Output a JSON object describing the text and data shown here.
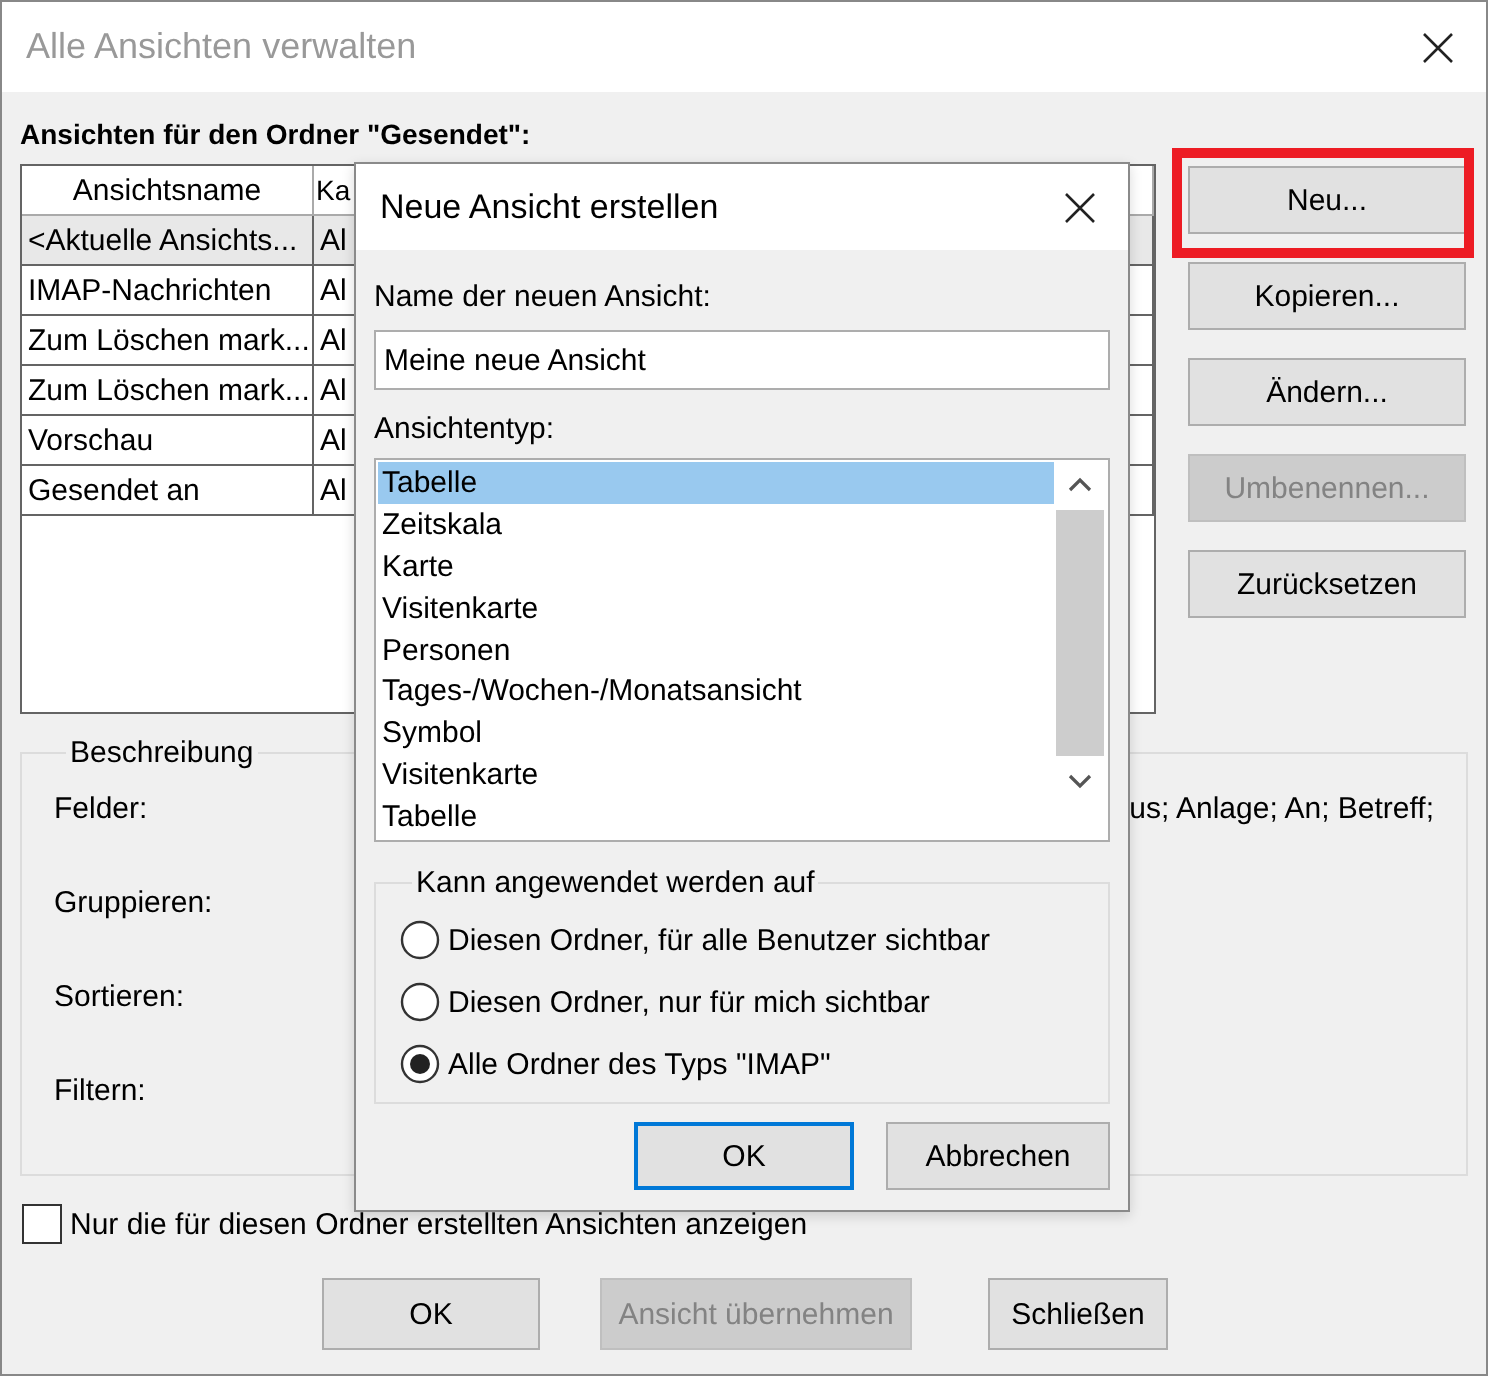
{
  "window": {
    "title": "Alle Ansichten verwalten"
  },
  "views_label": "Ansichten für den Ordner \"Gesendet\":",
  "table": {
    "columns": [
      "Ansichtsname",
      "Ka"
    ],
    "rows": [
      {
        "cells": [
          "<Aktuelle Ansichts...",
          "Al"
        ],
        "selected": true
      },
      {
        "cells": [
          "IMAP-Nachrichten",
          "Al"
        ],
        "selected": false
      },
      {
        "cells": [
          "Zum Löschen mark...",
          "Al"
        ],
        "selected": false
      },
      {
        "cells": [
          "Zum Löschen mark...",
          "Al"
        ],
        "selected": false
      },
      {
        "cells": [
          "Vorschau",
          "Al"
        ],
        "selected": false
      },
      {
        "cells": [
          "Gesendet an",
          "Al"
        ],
        "selected": false
      }
    ]
  },
  "side_buttons": [
    {
      "label": "Neu...",
      "disabled": false,
      "highlighted": true
    },
    {
      "label": "Kopieren...",
      "disabled": false,
      "highlighted": false
    },
    {
      "label": "Ändern...",
      "disabled": false,
      "highlighted": false
    },
    {
      "label": "Umbenennen...",
      "disabled": true,
      "highlighted": false
    },
    {
      "label": "Zurücksetzen",
      "disabled": false,
      "highlighted": false
    }
  ],
  "description": {
    "title": "Beschreibung",
    "rows": [
      {
        "label": "Felder:",
        "value": "us; Anlage; An; Betreff;"
      },
      {
        "label": "Gruppieren:"
      },
      {
        "label": "Sortieren:"
      },
      {
        "label": "Filtern:"
      }
    ]
  },
  "only_this_folder": {
    "label": "Nur die für diesen Ordner erstellten Ansichten anzeigen",
    "checked": false
  },
  "bottom_buttons": [
    {
      "label": "OK",
      "disabled": false
    },
    {
      "label": "Ansicht übernehmen",
      "disabled": true
    },
    {
      "label": "Schließen",
      "disabled": false
    }
  ],
  "new_view_dialog": {
    "title": "Neue Ansicht erstellen",
    "name_label": "Name der neuen Ansicht:",
    "name_value": "Meine neue Ansicht",
    "type_label": "Ansichtentyp:",
    "types": [
      {
        "label": "Tabelle",
        "selected": true
      },
      {
        "label": "Zeitskala",
        "selected": false
      },
      {
        "label": "Karte",
        "selected": false
      },
      {
        "label": "Visitenkarte",
        "selected": false
      },
      {
        "label": "Personen",
        "selected": false
      },
      {
        "label": "Tages-/Wochen-/Monatsansicht",
        "selected": false
      },
      {
        "label": "Symbol",
        "selected": false
      },
      {
        "label": "Visitenkarte",
        "selected": false
      },
      {
        "label": "Tabelle",
        "selected": false
      }
    ],
    "apply_group": {
      "title": "Kann angewendet werden auf",
      "options": [
        {
          "label": "Diesen Ordner, für alle Benutzer sichtbar",
          "selected": false
        },
        {
          "label": "Diesen Ordner, nur für mich sichtbar",
          "selected": false
        },
        {
          "label": "Alle Ordner des Typs \"IMAP\"",
          "selected": true
        }
      ]
    },
    "buttons": [
      {
        "label": "OK",
        "default": true
      },
      {
        "label": "Abbrechen",
        "default": false
      }
    ]
  }
}
